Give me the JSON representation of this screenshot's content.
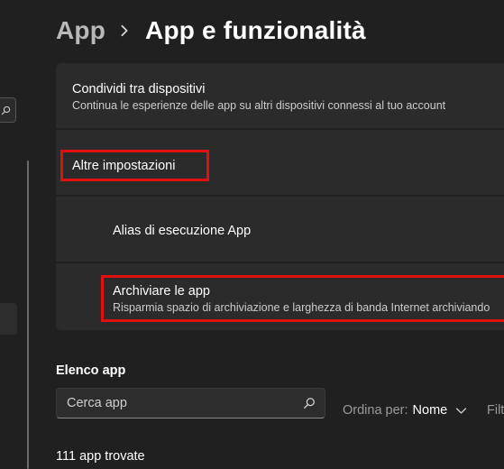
{
  "breadcrumb": {
    "parent": "App",
    "current": "App e funzionalità"
  },
  "settings": {
    "share": {
      "title": "Condividi tra dispositivi",
      "description": "Continua le esperienze delle app su altri dispositivi connessi al tuo account"
    },
    "more_settings": {
      "title": "Altre impostazioni"
    },
    "alias": {
      "title": "Alias di esecuzione App"
    },
    "archive": {
      "title": "Archiviare le app",
      "description": "Risparmia spazio di archiviazione e larghezza di banda Internet archiviando"
    }
  },
  "app_list": {
    "title": "Elenco app",
    "search_placeholder": "Cerca app",
    "sort_label": "Ordina per:",
    "sort_value": "Nome",
    "filter_label": "Filt",
    "count": "111 app trovate"
  },
  "colors": {
    "highlight": "#e01010",
    "background": "#202020",
    "card": "#2b2b2b"
  },
  "icons": {
    "search": "search-icon",
    "chevron_right": "chevron-right-icon",
    "chevron_down": "chevron-down-icon"
  }
}
